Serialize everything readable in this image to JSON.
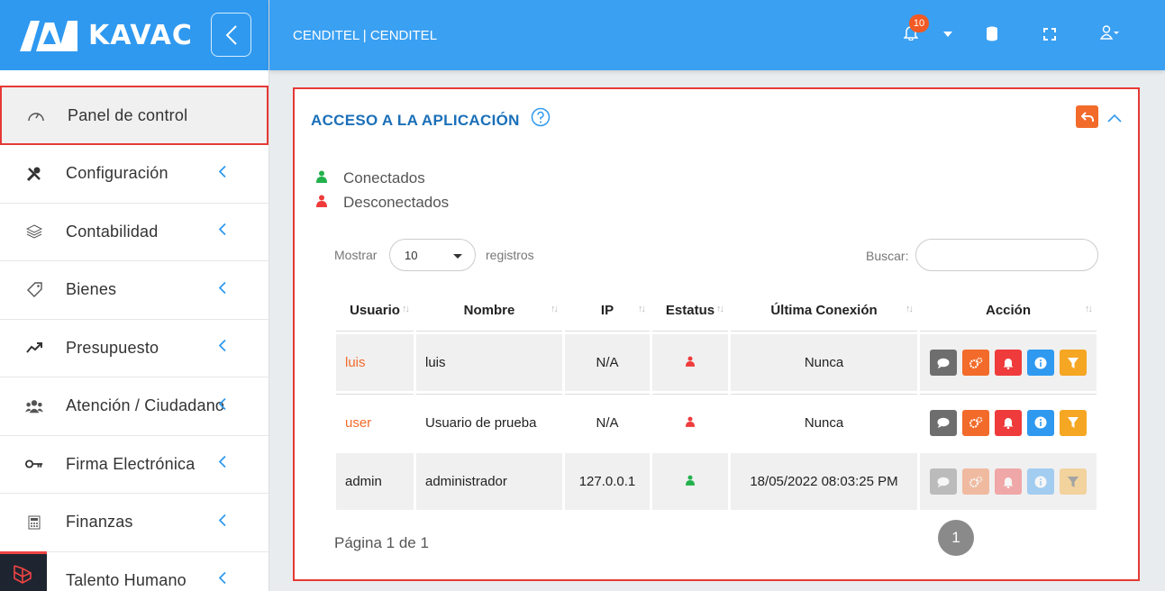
{
  "brand": {
    "name": "KAVAC"
  },
  "sidebar": {
    "items": [
      {
        "label": "Panel de control",
        "icon": "dashboard-icon",
        "active": true
      },
      {
        "label": "Configuración",
        "icon": "tools-icon"
      },
      {
        "label": "Contabilidad",
        "icon": "layers-icon"
      },
      {
        "label": "Bienes",
        "icon": "tag-icon"
      },
      {
        "label": "Presupuesto",
        "icon": "trend-icon"
      },
      {
        "label": "Atención / Ciudadano",
        "icon": "users-icon"
      },
      {
        "label": "Firma Electrónica",
        "icon": "key-icon"
      },
      {
        "label": "Finanzas",
        "icon": "calculator-icon"
      },
      {
        "label": "Talento Humano",
        "icon": "person-icon"
      }
    ]
  },
  "header": {
    "title": "CENDITEL | CENDITEL",
    "notifications": "10"
  },
  "card": {
    "title": "ACCESO A LA APLICACIÓN",
    "legend_connected": "Conectados",
    "legend_disconnected": "Desconectados",
    "show_label": "Mostrar",
    "page_size": "10",
    "records_label": "registros",
    "search_label": "Buscar:",
    "pagination_info": "Página 1 de 1",
    "current_page": "1"
  },
  "table": {
    "columns": [
      "Usuario",
      "Nombre",
      "IP",
      "Estatus",
      "Última Conexión",
      "Acción"
    ],
    "rows": [
      {
        "usuario": "luis",
        "nombre": "luis",
        "ip": "N/A",
        "status": "offline",
        "ultima": "Nunca"
      },
      {
        "usuario": "user",
        "nombre": "Usuario de prueba",
        "ip": "N/A",
        "status": "offline",
        "ultima": "Nunca"
      },
      {
        "usuario": "admin",
        "nombre": "administrador",
        "ip": "127.0.0.1",
        "status": "online",
        "ultima": "18/05/2022 08:03:25 PM"
      }
    ]
  },
  "colors": {
    "primary": "#3aa0f2",
    "title": "#1a6fb8",
    "online": "#22b14c",
    "offline": "#ef3b3b",
    "btn_message": "#6e6e6e",
    "btn_settings": "#f26b2a",
    "btn_bell": "#ef3b3b",
    "btn_info": "#2f99f0",
    "btn_filter": "#f5a623"
  }
}
